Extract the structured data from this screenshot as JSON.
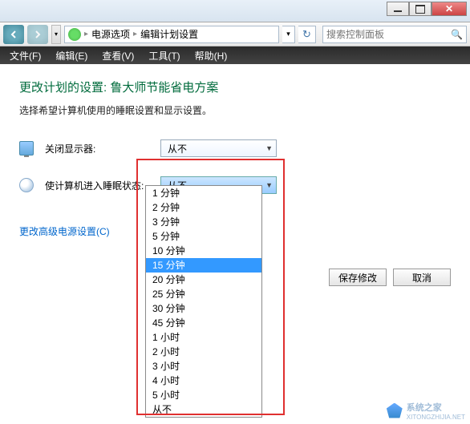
{
  "titlebar": {
    "close": "✕"
  },
  "nav": {
    "breadcrumb": {
      "item1": "电源选项",
      "item2": "编辑计划设置"
    },
    "search_placeholder": "搜索控制面板"
  },
  "menu": {
    "file": "文件(F)",
    "edit": "编辑(E)",
    "view": "查看(V)",
    "tools": "工具(T)",
    "help": "帮助(H)"
  },
  "page": {
    "heading": "更改计划的设置: 鲁大师节能省电方案",
    "subhead": "选择希望计算机使用的睡眠设置和显示设置。",
    "turn_off_display_label": "关闭显示器:",
    "turn_off_display_value": "从不",
    "sleep_label": "使计算机进入睡眠状态:",
    "sleep_value": "从不",
    "advanced_link": "更改高级电源设置(C)",
    "save_btn": "保存修改",
    "cancel_btn": "取消"
  },
  "dropdown": {
    "options": [
      "1 分钟",
      "2 分钟",
      "3 分钟",
      "5 分钟",
      "10 分钟",
      "15 分钟",
      "20 分钟",
      "25 分钟",
      "30 分钟",
      "45 分钟",
      "1 小时",
      "2 小时",
      "3 小时",
      "4 小时",
      "5 小时",
      "从不"
    ],
    "selected_index": 5
  },
  "watermark": {
    "text": "系统之家",
    "url": "XITONGZHIJIA.NET"
  }
}
